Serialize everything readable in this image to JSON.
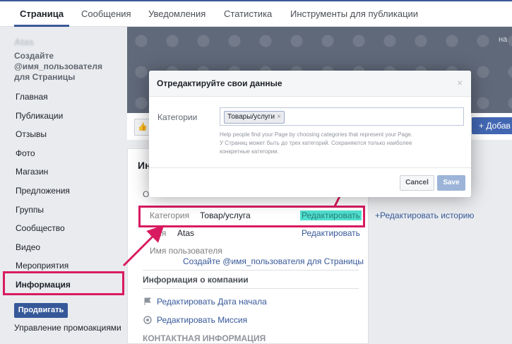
{
  "topnav": {
    "tabs": [
      {
        "label": "Страница",
        "active": true
      },
      {
        "label": "Сообщения",
        "active": false
      },
      {
        "label": "Уведомления",
        "active": false
      },
      {
        "label": "Статистика",
        "active": false
      },
      {
        "label": "Инструменты для публикации",
        "active": false
      }
    ]
  },
  "sidebar": {
    "page_name": "Atas",
    "username_prompt": "Создайте @имя_пользователя для Страницы",
    "items": [
      {
        "label": "Главная"
      },
      {
        "label": "Публикации"
      },
      {
        "label": "Отзывы"
      },
      {
        "label": "Фото"
      },
      {
        "label": "Магазин"
      },
      {
        "label": "Предложения"
      },
      {
        "label": "Группы"
      },
      {
        "label": "Сообщество"
      },
      {
        "label": "Видео"
      },
      {
        "label": "Мероприятия"
      },
      {
        "label": "Информация",
        "active": true
      }
    ],
    "promote_label": "Продвигать",
    "manage_promotions": "Управление промоакциями"
  },
  "cover": {
    "corner_text": "на",
    "add_button": "+ Добав"
  },
  "about": {
    "title": "Ин",
    "subtitle": "О",
    "category_label": "Категория",
    "category_value": "Товар/услуга",
    "category_edit": "Редактировать",
    "edit_history": "+Редактировать историю",
    "name_label": "Имя",
    "name_value": "Atas",
    "name_edit": "Редактировать",
    "username_label": "Имя пользователя",
    "username_link": "Создайте @имя_пользователя для Страницы",
    "company_header": "Информация о компании",
    "edit_start_date": "Редактировать Дата начала",
    "edit_mission": "Редактировать Миссия",
    "contact_header": "КОНТАКТНАЯ ИНФОРМАЦИЯ"
  },
  "modal": {
    "title": "Отредактируйте свои данные",
    "close": "×",
    "categories_label": "Категории",
    "chip": "Товары/услуги",
    "help_line1": "Help people find your Page by choosing categories that represent your Page.",
    "help_line2": "У Страниц может быть до трех категорий. Сохраняются только наиболее",
    "help_line3": "конкретные категории.",
    "cancel": "Cancel",
    "save": "Save"
  },
  "colors": {
    "brand": "#3b5998",
    "highlight": "#d81b60",
    "edit_highlight": "#4fe0cf"
  }
}
